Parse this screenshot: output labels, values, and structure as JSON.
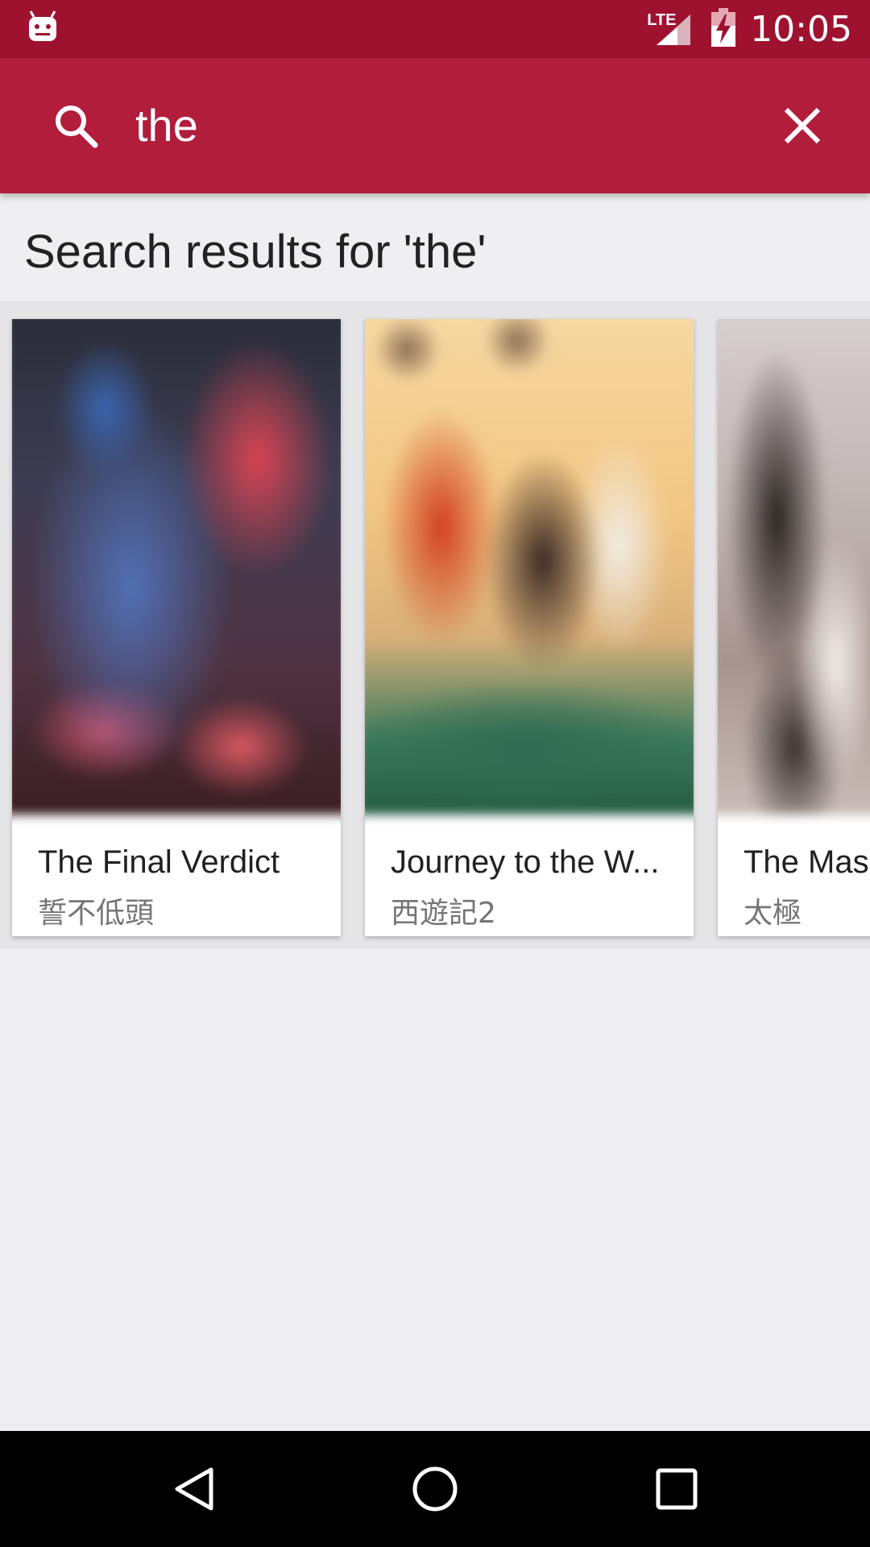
{
  "status_bar": {
    "time": "10:05",
    "network_label": "LTE",
    "icons": [
      "android-notification-icon",
      "signal-icon",
      "battery-charging-icon"
    ],
    "background_color": "#9e1230"
  },
  "search": {
    "query": "the",
    "search_icon": "search-icon",
    "clear_icon": "close-icon",
    "bar_color": "#b11d3b"
  },
  "results": {
    "heading": "Search results for 'the'",
    "items": [
      {
        "title": "The Final Verdict",
        "subtitle": "誓不低頭"
      },
      {
        "title": "Journey to the W...",
        "subtitle": "西遊記2"
      },
      {
        "title": "The Mas",
        "subtitle": "太極"
      }
    ]
  },
  "nav_bar": {
    "buttons": [
      "back-icon",
      "home-icon",
      "recents-icon"
    ]
  }
}
